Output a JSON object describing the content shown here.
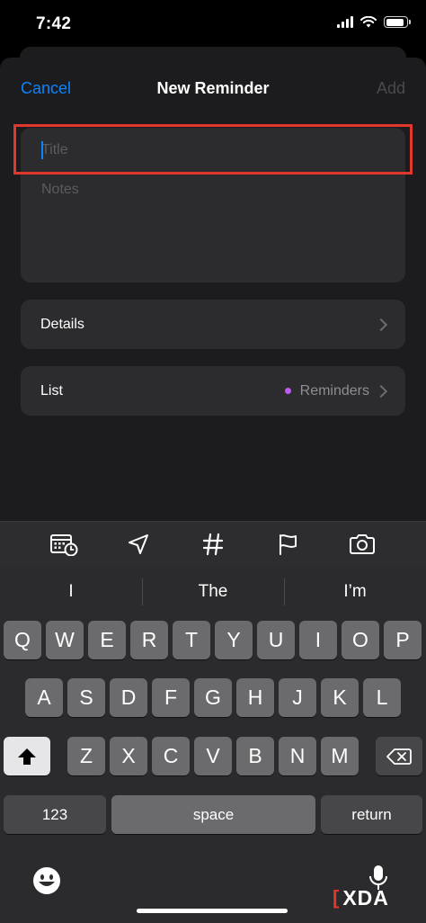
{
  "status_bar": {
    "time": "7:42",
    "signal_bars": 4,
    "wifi": "wifi-icon",
    "battery_level": 0.9
  },
  "nav": {
    "cancel_label": "Cancel",
    "title": "New Reminder",
    "add_label": "Add"
  },
  "form": {
    "title_placeholder": "Title",
    "notes_placeholder": "Notes"
  },
  "rows": {
    "details_label": "Details",
    "list_label": "List",
    "list_value": "Reminders",
    "list_dot_color": "#bf5af2"
  },
  "toolbar": {
    "icons": [
      "calendar-clock-icon",
      "location-arrow-icon",
      "hashtag-icon",
      "flag-icon",
      "camera-icon"
    ]
  },
  "keyboard": {
    "suggestions": [
      "I",
      "The",
      "I’m"
    ],
    "row1": [
      "Q",
      "W",
      "E",
      "R",
      "T",
      "Y",
      "U",
      "I",
      "O",
      "P"
    ],
    "row2": [
      "A",
      "S",
      "D",
      "F",
      "G",
      "H",
      "J",
      "K",
      "L"
    ],
    "row3": [
      "Z",
      "X",
      "C",
      "V",
      "B",
      "N",
      "M"
    ],
    "numbers_label": "123",
    "space_label": "space",
    "return_label": "return"
  },
  "watermark": {
    "bracket": "[",
    "text": "XDA"
  },
  "colors": {
    "accent": "#0a84ff",
    "highlight": "#e0382c"
  }
}
